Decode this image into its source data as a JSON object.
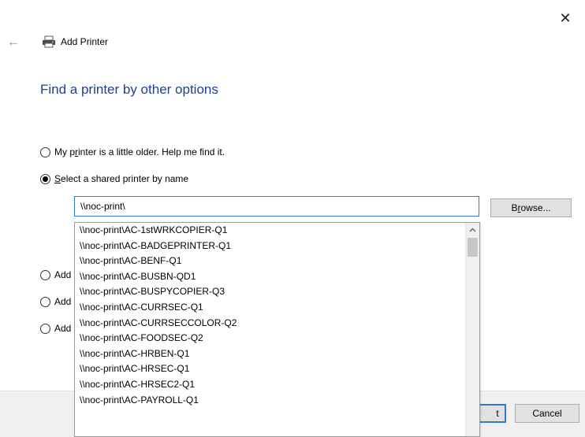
{
  "window": {
    "title": "Add Printer",
    "close_glyph": "✕",
    "back_glyph": "←",
    "icons": {
      "back": "back-arrow-icon",
      "printer": "printer-icon",
      "close": "close-icon"
    }
  },
  "heading": "Find a printer by other options",
  "options": {
    "older": {
      "pre": "My p",
      "key": "r",
      "post": "inter is a little older. Help me find it.",
      "checked": false
    },
    "shared": {
      "pre": "",
      "key": "S",
      "post": "elect a shared printer by name",
      "checked": true
    },
    "hidden_options": [
      {
        "visible_text": "Add",
        "checked": false
      },
      {
        "visible_text": "Add",
        "checked": false
      },
      {
        "visible_text": "Add",
        "checked": false
      }
    ]
  },
  "shared_printer_input": {
    "value": "\\\\noc-print\\"
  },
  "browse_button": {
    "pre": "B",
    "key": "r",
    "post": "owse..."
  },
  "autocomplete": {
    "items": [
      "\\\\noc-print\\AC-1stWRKCOPIER-Q1",
      "\\\\noc-print\\AC-BADGEPRINTER-Q1",
      "\\\\noc-print\\AC-BENF-Q1",
      "\\\\noc-print\\AC-BUSBN-QD1",
      "\\\\noc-print\\AC-BUSPYCOPIER-Q3",
      "\\\\noc-print\\AC-CURRSEC-Q1",
      "\\\\noc-print\\AC-CURRSECCOLOR-Q2",
      "\\\\noc-print\\AC-FOODSEC-Q2",
      "\\\\noc-print\\AC-HRBEN-Q1",
      "\\\\noc-print\\AC-HRSEC-Q1",
      "\\\\noc-print\\AC-HRSEC2-Q1",
      "\\\\noc-print\\AC-PAYROLL-Q1"
    ],
    "scroll_up_glyph": "▲"
  },
  "footer": {
    "next_label_visible": "t",
    "cancel_label": "Cancel"
  },
  "colors": {
    "heading": "#1e3f92",
    "focus_border": "#2f7bd1",
    "button_face": "#e1e1e1",
    "footer_bg": "#f0f0f0"
  }
}
